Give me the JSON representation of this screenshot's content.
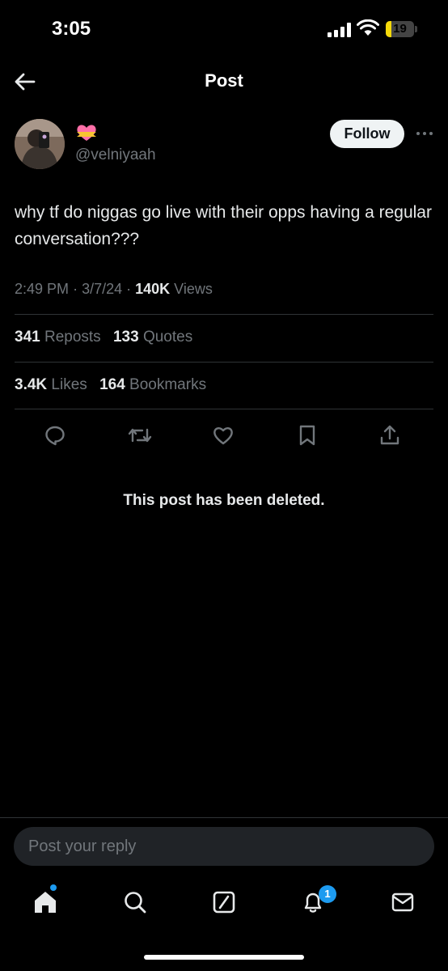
{
  "status_bar": {
    "time": "3:05",
    "battery_level": "19",
    "battery_color": "#f5d90a"
  },
  "header": {
    "title": "Post",
    "back_icon": "arrow-left-icon"
  },
  "post": {
    "author_emoji_icon": "heart-ribbon-emoji-icon",
    "handle": "@velniyaah",
    "follow_label": "Follow",
    "text": "why tf do niggas go live with their opps having a regular conversation???",
    "time": "2:49 PM",
    "date": "3/7/24",
    "views_count": "140K",
    "views_label": "Views",
    "reposts_count": "341",
    "reposts_label": "Reposts",
    "quotes_count": "133",
    "quotes_label": "Quotes",
    "likes_count": "3.4K",
    "likes_label": "Likes",
    "bookmarks_count": "164",
    "bookmarks_label": "Bookmarks",
    "deleted_notice": "This post has been deleted."
  },
  "actions": [
    "reply-icon",
    "repost-icon",
    "like-icon",
    "bookmark-icon",
    "share-icon"
  ],
  "reply": {
    "placeholder": "Post your reply"
  },
  "bottom_nav": {
    "items": [
      "home-icon",
      "search-icon",
      "grok-icon",
      "notifications-icon",
      "messages-icon"
    ],
    "notification_badge": "1",
    "accent_color": "#1d9bf0"
  }
}
